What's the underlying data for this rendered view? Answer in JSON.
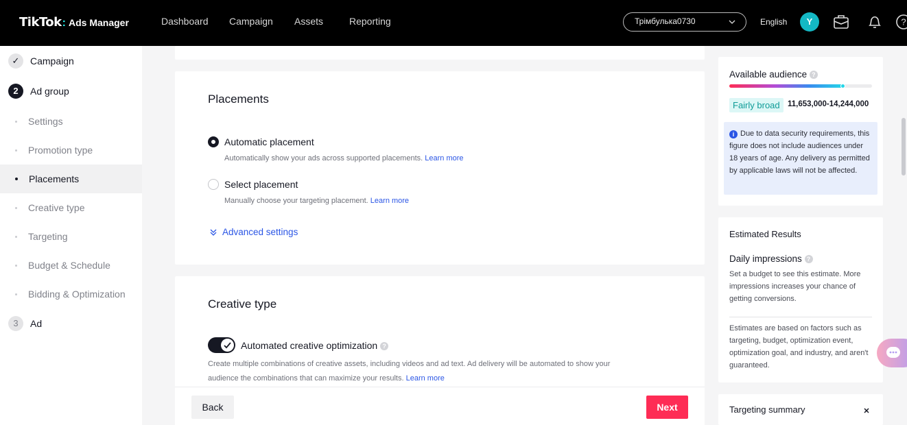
{
  "app": {
    "logo_main": "TikTok",
    "logo_sep": ":",
    "logo_sub": "Ads Manager",
    "nav": [
      "Dashboard",
      "Campaign",
      "Assets",
      "Reporting"
    ],
    "account_name": "Трімбулька0730",
    "language": "English",
    "avatar_letter": "Y"
  },
  "sidebar": {
    "steps": [
      {
        "num": "✓",
        "label": "Campaign"
      },
      {
        "num": "2",
        "label": "Ad group"
      },
      {
        "num": "3",
        "label": "Ad"
      }
    ],
    "subitems": [
      "Settings",
      "Promotion type",
      "Placements",
      "Creative type",
      "Targeting",
      "Budget & Schedule",
      "Bidding & Optimization"
    ],
    "active_subitem": "Placements"
  },
  "placements": {
    "title": "Placements",
    "auto_label": "Automatic placement",
    "auto_desc": "Automatically show your ads across supported placements.",
    "select_label": "Select placement",
    "select_desc": "Manually choose your targeting placement.",
    "learn_more": "Learn more",
    "advanced": "Advanced settings"
  },
  "creative": {
    "title": "Creative type",
    "toggle_label": "Automated creative optimization",
    "toggle_on": true,
    "desc_line1": "Create multiple combinations of creative assets, including videos and ad text. Ad delivery will be automated to show your",
    "desc_line2": "audience the combinations that can maximize your results.",
    "learn_more": "Learn more"
  },
  "footer": {
    "back": "Back",
    "next": "Next"
  },
  "audience": {
    "title": "Available audience",
    "level_fraction": 0.8,
    "tag": "Fairly broad",
    "range": "11,653,000-14,244,000",
    "notice": "Due to data security requirements, this figure does not include audiences under 18 years of age. Any delivery as permitted by applicable laws will not be affected."
  },
  "estimated": {
    "title": "Estimated Results",
    "daily_title": "Daily impressions",
    "daily_desc": "Set a budget to see this estimate. More impressions increases your chance of getting conversions.",
    "footnote": "Estimates are based on factors such as targeting, budget, optimization event, optimization goal, and industry, and aren't guaranteed."
  },
  "targeting_summary": {
    "title": "Targeting summary"
  },
  "colors": {
    "brand_red": "#fe2c55",
    "link_blue": "#2a55e5",
    "teal": "#25f4ee"
  }
}
